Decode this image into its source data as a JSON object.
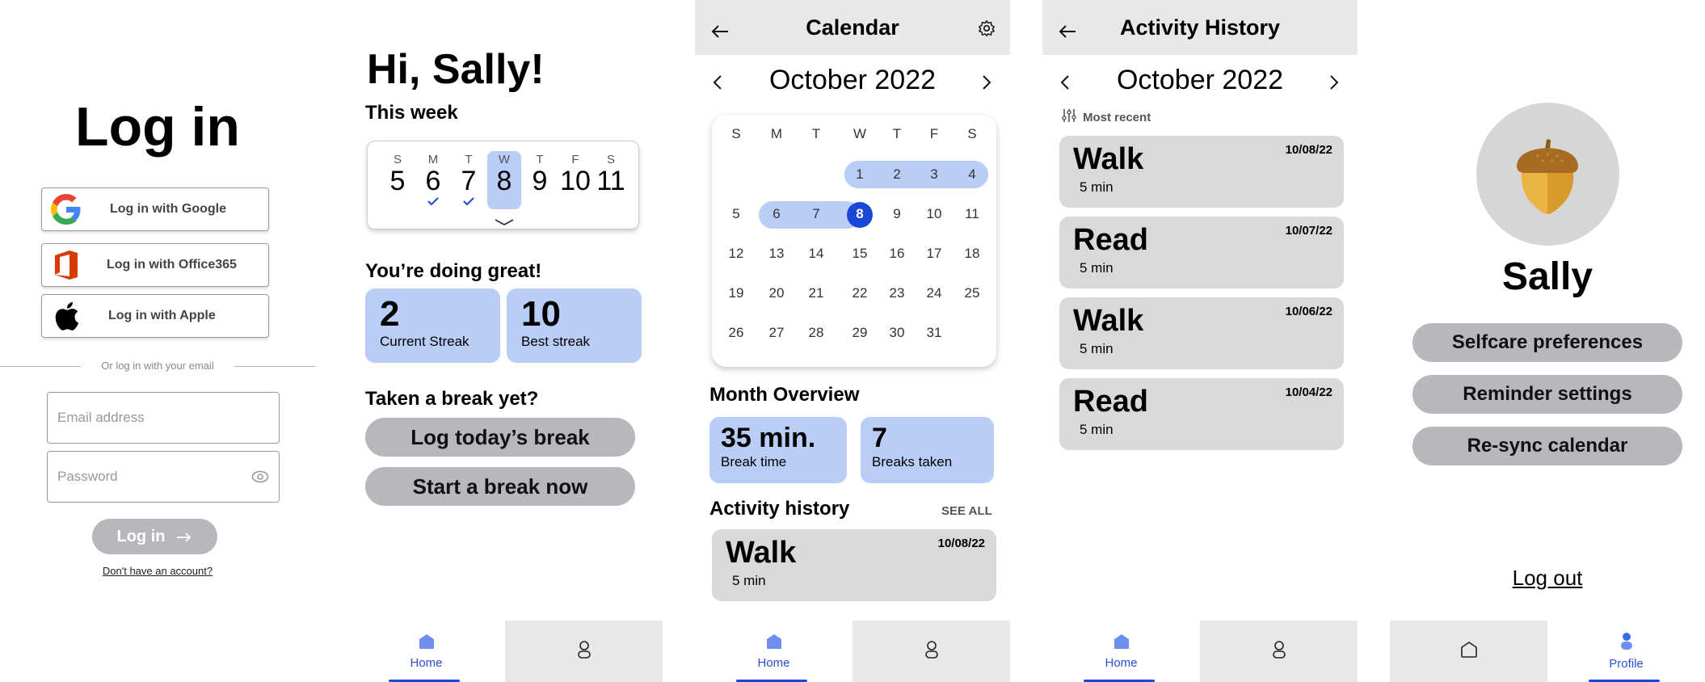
{
  "login": {
    "title": "Log in",
    "google_label": "Log in with Google",
    "office_label": "Log in with Office365",
    "apple_label": "Log in with Apple",
    "divider_text": "Or log in with your email",
    "email_placeholder": "Email address",
    "password_placeholder": "Password",
    "submit_label": "Log in",
    "signup_link": "Don't have an account?"
  },
  "home": {
    "greeting": "Hi, Sally!",
    "week_title": "This week",
    "week_days": [
      {
        "letter": "S",
        "num": "5"
      },
      {
        "letter": "M",
        "num": "6"
      },
      {
        "letter": "T",
        "num": "7"
      },
      {
        "letter": "W",
        "num": "8"
      },
      {
        "letter": "T",
        "num": "9"
      },
      {
        "letter": "F",
        "num": "10"
      },
      {
        "letter": "S",
        "num": "11"
      }
    ],
    "doing_great": "You’re doing great!",
    "current_streak_value": "2",
    "current_streak_label": "Current Streak",
    "best_streak_value": "10",
    "best_streak_label": "Best streak",
    "break_title": "Taken a break yet?",
    "log_break_label": "Log today’s break",
    "start_break_label": "Start a break now"
  },
  "nav": {
    "home_label": "Home",
    "profile_label": "Profile"
  },
  "calendar": {
    "header_title": "Calendar",
    "month_label": "October 2022",
    "weekday_letters": [
      "S",
      "M",
      "T",
      "W",
      "T",
      "F",
      "S"
    ],
    "rows": [
      [
        "",
        "",
        "",
        "1",
        "2",
        "3",
        "4"
      ],
      [
        "5",
        "6",
        "7",
        "8",
        "9",
        "10",
        "11"
      ],
      [
        "12",
        "13",
        "14",
        "15",
        "16",
        "17",
        "18"
      ],
      [
        "19",
        "20",
        "21",
        "22",
        "23",
        "24",
        "25"
      ],
      [
        "26",
        "27",
        "28",
        "29",
        "30",
        "31",
        ""
      ]
    ],
    "overview_title": "Month Overview",
    "break_time_value": "35 min.",
    "break_time_label": "Break time",
    "breaks_taken_value": "7",
    "breaks_taken_label": "Breaks taken",
    "activity_title": "Activity history",
    "see_all": "SEE ALL",
    "recent": {
      "name": "Walk",
      "duration": "5 min",
      "date": "10/08/22"
    }
  },
  "history": {
    "header_title": "Activity History",
    "month_label": "October 2022",
    "filter_label": "Most recent",
    "items": [
      {
        "name": "Walk",
        "duration": "5 min",
        "date": "10/08/22"
      },
      {
        "name": "Read",
        "duration": "5 min",
        "date": "10/07/22"
      },
      {
        "name": "Walk",
        "duration": "5 min",
        "date": "10/06/22"
      },
      {
        "name": "Read",
        "duration": "5 min",
        "date": "10/04/22"
      }
    ]
  },
  "profile": {
    "name": "Sally",
    "selfcare_label": "Selfcare preferences",
    "reminder_label": "Reminder settings",
    "resync_label": "Re-sync calendar",
    "logout_label": "Log out"
  },
  "colors": {
    "accent": "#1a47d8",
    "light_blue": "#b9cdf7",
    "gray_pill": "#b7b7bc",
    "card_gray": "#d9d9d9",
    "header_gray": "#e8e8e8"
  }
}
